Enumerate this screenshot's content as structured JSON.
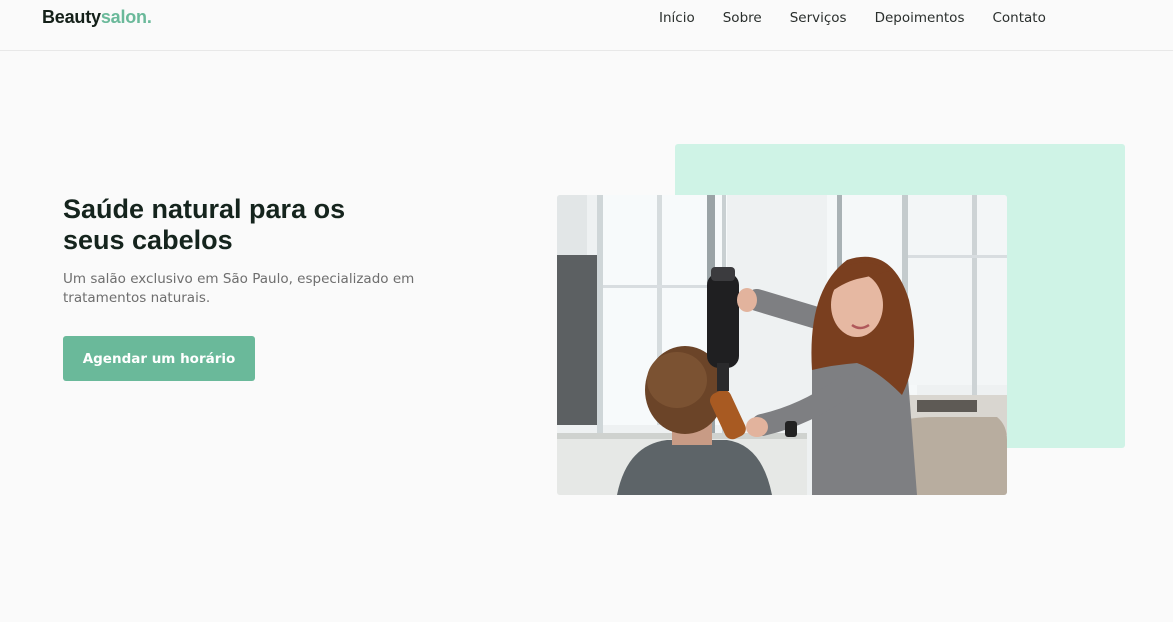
{
  "header": {
    "logo_brand": "Beauty",
    "logo_suffix": "salon.",
    "nav": [
      {
        "label": "Início"
      },
      {
        "label": "Sobre"
      },
      {
        "label": "Serviços"
      },
      {
        "label": "Depoimentos"
      },
      {
        "label": "Contato"
      }
    ]
  },
  "hero": {
    "title": "Saúde natural para os seus cabelos",
    "subtitle": "Um salão exclusivo em São Paulo, especializado em tratamentos naturais.",
    "cta_label": "Agendar um horário",
    "image_alt": "Cabeleireira secando o cabelo de uma cliente no salão"
  },
  "colors": {
    "accent": "#6ab99a",
    "accent_light": "#cff3e6",
    "background": "#fafafa",
    "text_dark": "#15241d"
  }
}
